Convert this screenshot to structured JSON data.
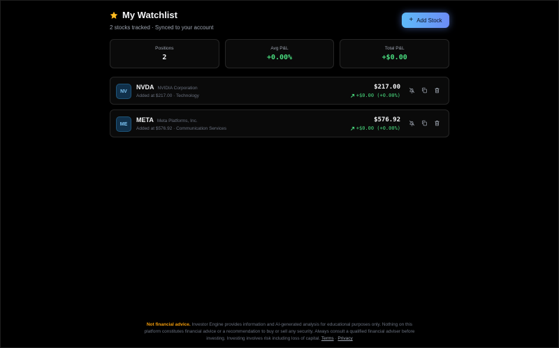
{
  "header": {
    "title": "My Watchlist",
    "subtitle": "2 stocks tracked · Synced to your account",
    "add_label": "Add Stock"
  },
  "stats": [
    {
      "label": "Positions",
      "value": "2",
      "color": "white"
    },
    {
      "label": "Avg P&L",
      "value": "+0.00%",
      "color": "green"
    },
    {
      "label": "Total P&L",
      "value": "+$0.00",
      "color": "green"
    }
  ],
  "stocks": [
    {
      "avatar": "NV",
      "ticker": "NVDA",
      "company": "NVIDIA Corporation",
      "meta": "Added at $217.00 · Technology",
      "price": "$217.00",
      "change": "+$0.00 (+0.00%)"
    },
    {
      "avatar": "ME",
      "ticker": "META",
      "company": "Meta Platforms, Inc.",
      "meta": "Added at $576.92 · Communication Services",
      "price": "$576.92",
      "change": "+$0.00 (+0.00%)"
    }
  ],
  "footer": {
    "warning": "Not financial advice.",
    "line1": "Investor Engine provides information and AI-generated analysis for educational purposes only. Nothing on this",
    "line2": "platform constitutes financial advice or a recommendation to buy or sell any security. Always consult a qualified financial adviser before",
    "line3": "investing. Investing involves risk including loss of capital.",
    "terms": "Terms",
    "separator": "·",
    "privacy": "Privacy"
  },
  "colors": {
    "accent_gradient_start": "#5eb9f8",
    "accent_gradient_end": "#6c8cf6",
    "positive": "#4ade80",
    "warning": "#f59e0b",
    "star": "#fbbf24"
  },
  "icons": {
    "title": "star-icon",
    "add": "plus-icon",
    "change": "arrow-up-right-icon",
    "row_actions": [
      "bell-off-icon",
      "copy-icon",
      "trash-icon"
    ]
  }
}
